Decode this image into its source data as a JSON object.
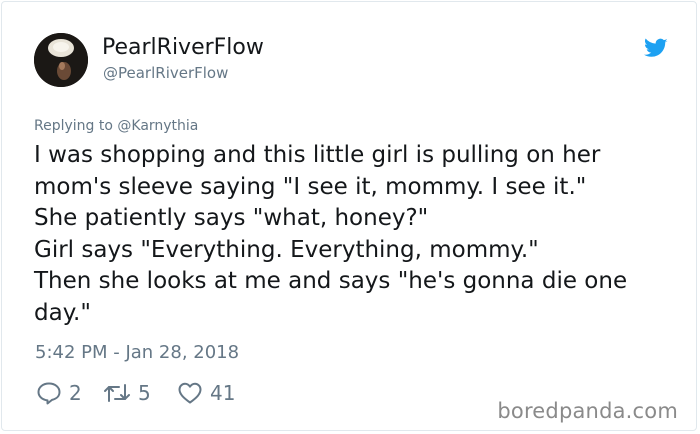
{
  "tweet": {
    "display_name": "PearlRiverFlow",
    "handle": "@PearlRiverFlow",
    "replying_to": "Replying to @Karnythia",
    "body_lines": [
      "I was shopping and this little girl is pulling on her",
      "mom's sleeve saying \"I see it, mommy. I see it.\"",
      "She patiently says \"what, honey?\"",
      "Girl says \"Everything. Everything, mommy.\"",
      "Then she looks at me and says \"he's gonna die one",
      "day.\""
    ],
    "timestamp": "5:42 PM - Jan 28, 2018",
    "actions": {
      "reply_count": "2",
      "retweet_count": "5",
      "like_count": "41"
    },
    "icons": {
      "brand": "twitter-bird-icon",
      "reply": "reply-icon",
      "retweet": "retweet-icon",
      "like": "heart-icon"
    }
  },
  "watermark": "boredpanda.com",
  "colors": {
    "text_primary": "#14171a",
    "text_secondary": "#657786",
    "twitter_blue": "#1da1f2",
    "card_border": "#e1e8ed",
    "watermark": "#8a8a8a"
  }
}
